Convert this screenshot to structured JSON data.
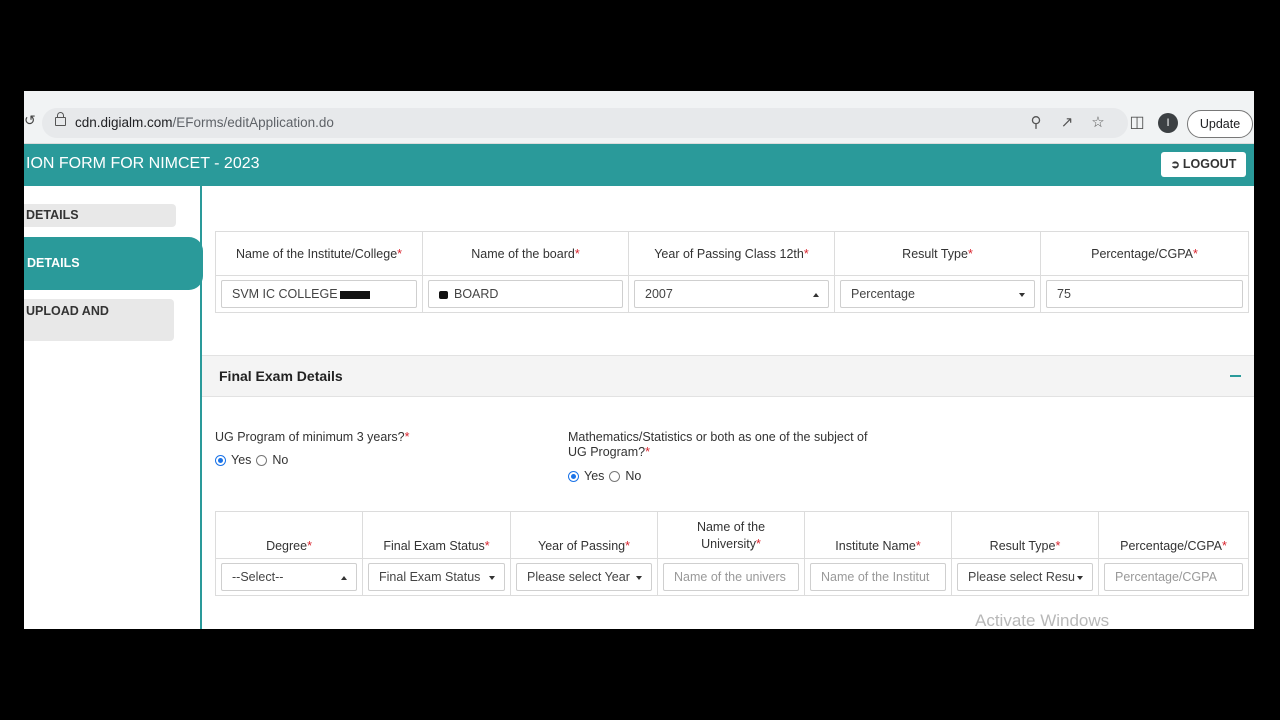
{
  "browser": {
    "url_domain": "cdn.digialm.com",
    "url_path": "/EForms/editApplication.do",
    "profile_initial": "I",
    "update_label": "Update",
    "icons": [
      "zoom-icon",
      "share-icon",
      "star-icon",
      "side-panel-icon"
    ]
  },
  "header": {
    "title": "ION FORM FOR NIMCET - 2023",
    "logout_label": "LOGOUT",
    "bg_color": "#2a9a9a"
  },
  "sidebar": {
    "items": [
      {
        "label": "DETAILS"
      },
      {
        "label": "DETAILS"
      },
      {
        "label": "UPLOAD AND"
      }
    ]
  },
  "class12": {
    "columns": [
      "Name of the Institute/College",
      "Name of the board",
      "Year of Passing Class 12th",
      "Result Type",
      "Percentage/CGPA"
    ],
    "values": {
      "institute": "SVM IC COLLEGE",
      "board": "BOARD",
      "year": "2007",
      "result_type": "Percentage",
      "percentage": "75"
    }
  },
  "final_exam": {
    "title": "Final Exam Details",
    "ug_question": "UG Program of minimum 3 years?",
    "math_question_line1": "Mathematics/Statistics or both as one of the subject of",
    "math_question_line2": "UG Program?",
    "yes_label": "Yes",
    "no_label": "No",
    "ug_answer": "Yes",
    "math_answer": "Yes",
    "columns": [
      "Degree",
      "Final Exam Status",
      "Year of Passing",
      "Name of the",
      "University",
      "Institute Name",
      "Result Type",
      "Percentage/CGPA"
    ],
    "fields": {
      "degree": "--Select--",
      "status": "Final Exam Status",
      "year": "Please select Year",
      "university_ph": "Name of the univers",
      "institute_ph": "Name of the Institut",
      "result_type": "Please select Resu",
      "percentage_ph": "Percentage/CGPA"
    }
  },
  "watermark": "Activate Windows"
}
